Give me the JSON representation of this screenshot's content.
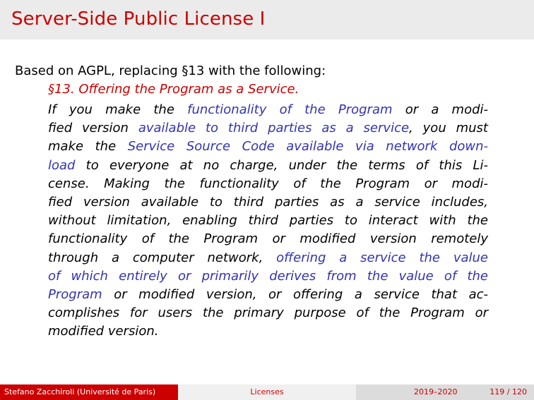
{
  "slide": {
    "title": "Server-Side Public License I",
    "lead": "Based on AGPL, replacing §13 with the following:",
    "section_heading": "§13. Offering the Program as a Service.",
    "body_lines": [
      [
        {
          "t": "If you make the ",
          "c": "black"
        },
        {
          "t": "functionality of the Program",
          "c": "blue"
        },
        {
          "t": " or a modi-",
          "c": "black"
        }
      ],
      [
        {
          "t": "fied version ",
          "c": "black"
        },
        {
          "t": "available to third parties as a service",
          "c": "blue"
        },
        {
          "t": ", you must",
          "c": "black"
        }
      ],
      [
        {
          "t": "make the ",
          "c": "black"
        },
        {
          "t": "Service Source Code available via network down-",
          "c": "blue"
        }
      ],
      [
        {
          "t": "load",
          "c": "blue"
        },
        {
          "t": " to everyone at no charge, under the terms of this Li-",
          "c": "black"
        }
      ],
      [
        {
          "t": "cense.  Making the functionality of the Program or modi-",
          "c": "black"
        }
      ],
      [
        {
          "t": "fied version available to third parties as a service includes,",
          "c": "black"
        }
      ],
      [
        {
          "t": "without limitation, enabling third parties to interact with the",
          "c": "black"
        }
      ],
      [
        {
          "t": "functionality of the Program or modified version remotely",
          "c": "black"
        }
      ],
      [
        {
          "t": "through a computer network, ",
          "c": "black"
        },
        {
          "t": "offering a service the value",
          "c": "blue"
        }
      ],
      [
        {
          "t": "of which entirely or primarily derives from the value of the",
          "c": "blue"
        }
      ],
      [
        {
          "t": "Program",
          "c": "blue"
        },
        {
          "t": " or modified version, or offering a service that ac-",
          "c": "black"
        }
      ],
      [
        {
          "t": "complishes for users the primary purpose of the Program or",
          "c": "black"
        }
      ],
      [
        {
          "t": "modified version.",
          "c": "black"
        }
      ]
    ]
  },
  "footer": {
    "author": "Stefano Zacchiroli  (Université de Paris)",
    "topic": "Licenses",
    "date": "2019–2020",
    "page": "119 / 120"
  },
  "colors": {
    "accent": "#cc0000",
    "highlight": "#3333b3",
    "title_bg": "#ebebeb"
  }
}
